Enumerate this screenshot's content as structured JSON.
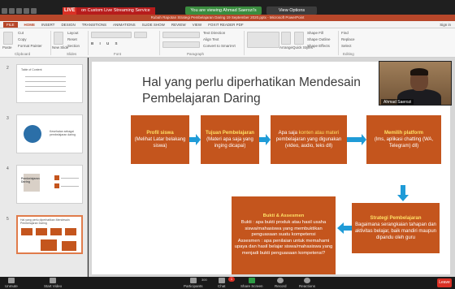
{
  "meeting": {
    "live_badge": "LIVE",
    "live_stream_label": "on Custom Live Streaming Service",
    "viewing_banner": "You are viewing Ahmad Saerozi's screen",
    "view_options": "View Options"
  },
  "ppt": {
    "window_title": "Rubah Rapotan Strategi Pembelajaran Daring 19 September 2020.pptx - Microsoft PowerPoint",
    "tabs": [
      "FILE",
      "HOME",
      "INSERT",
      "DESIGN",
      "TRANSITIONS",
      "ANIMATIONS",
      "SLIDE SHOW",
      "REVIEW",
      "VIEW",
      "FOXIT READER PDF"
    ],
    "sign_in": "Sign in",
    "ribbon": {
      "cut": "Cut",
      "copy": "Copy",
      "format_painter": "Format Painter",
      "clipboard": "Clipboard",
      "new_slide": "New Slide",
      "layout": "Layout",
      "reset": "Reset",
      "section": "Section",
      "slides": "Slides",
      "font": "Font",
      "paragraph": "Paragraph",
      "text_direction": "Text Direction",
      "align_text": "Align Text",
      "convert_smartart": "Convert to SmartArt",
      "arrange": "Arrange",
      "quick_styles": "Quick Styles",
      "shape_fill": "Shape Fill",
      "shape_outline": "Shape Outline",
      "shape_effects": "Shape Effects",
      "find": "Find",
      "replace": "Replace",
      "select": "Select",
      "editing": "Editing",
      "paste": "Paste"
    },
    "thumbnails": [
      {
        "num": "2",
        "title": "Table of Content"
      },
      {
        "num": "3",
        "title": "Kesehatan sebagai pembelajaran daring"
      },
      {
        "num": "4",
        "title": "Pembelajaran Daring"
      },
      {
        "num": "5",
        "title": "Hal yang perlu diperhatikan Mendesain Pembelajaran Daring"
      }
    ]
  },
  "slide": {
    "title": "Hal yang perlu diperhatikan Mendesain Pembelajaran Daring",
    "boxes": {
      "profil": {
        "heading": "Profil siswa",
        "body": "(Melihat Latar belakang siswa)"
      },
      "tujuan": {
        "heading": "Tujuan Pembelajaran",
        "body": "(Materi apa saja yang inging dicapai)"
      },
      "konten": {
        "pre": "Apa saja ",
        "highlight": "konten atau materi",
        "body": " pembelajaran yang digunakan (video, audio, teks dll)"
      },
      "platform": {
        "heading": "Memilih platform",
        "body": "(lms, aplikasi chatting (WA, Telegram) dll)"
      },
      "strategi": {
        "heading": "Strategi Pembelajaran",
        "body": "Bagaimana serangkaian tahapan dan aktivitas belajar, baik mandiri maupun dipandu oleh guru"
      },
      "bukti": {
        "heading": "Bukti & Assesmen",
        "body1": "Bukti : apa bukti produk atau hasil usaha siswa/mahasiswa yang membuktikan penguasaan suatu kompetensi",
        "body2": "Assesmen : apa penilaian untuk memahami upaya dan hasil belajar siswa/mahasiswa yang menjadi bukti penguasaan kompetensi?"
      }
    },
    "colors": {
      "box": "#c4551d",
      "arrow": "#1f9bd7",
      "highlight": "#ffe066"
    }
  },
  "webcam": {
    "name": "Ahmad Saerozi"
  },
  "toolbar": {
    "unmute": "Unmute",
    "start_video": "Start Video",
    "participants": "Participants",
    "participants_count": "300",
    "chat": "Chat",
    "chat_badge": "1",
    "share_screen": "Share Screen",
    "record": "Record",
    "reactions": "Reactions",
    "leave": "Leave"
  }
}
